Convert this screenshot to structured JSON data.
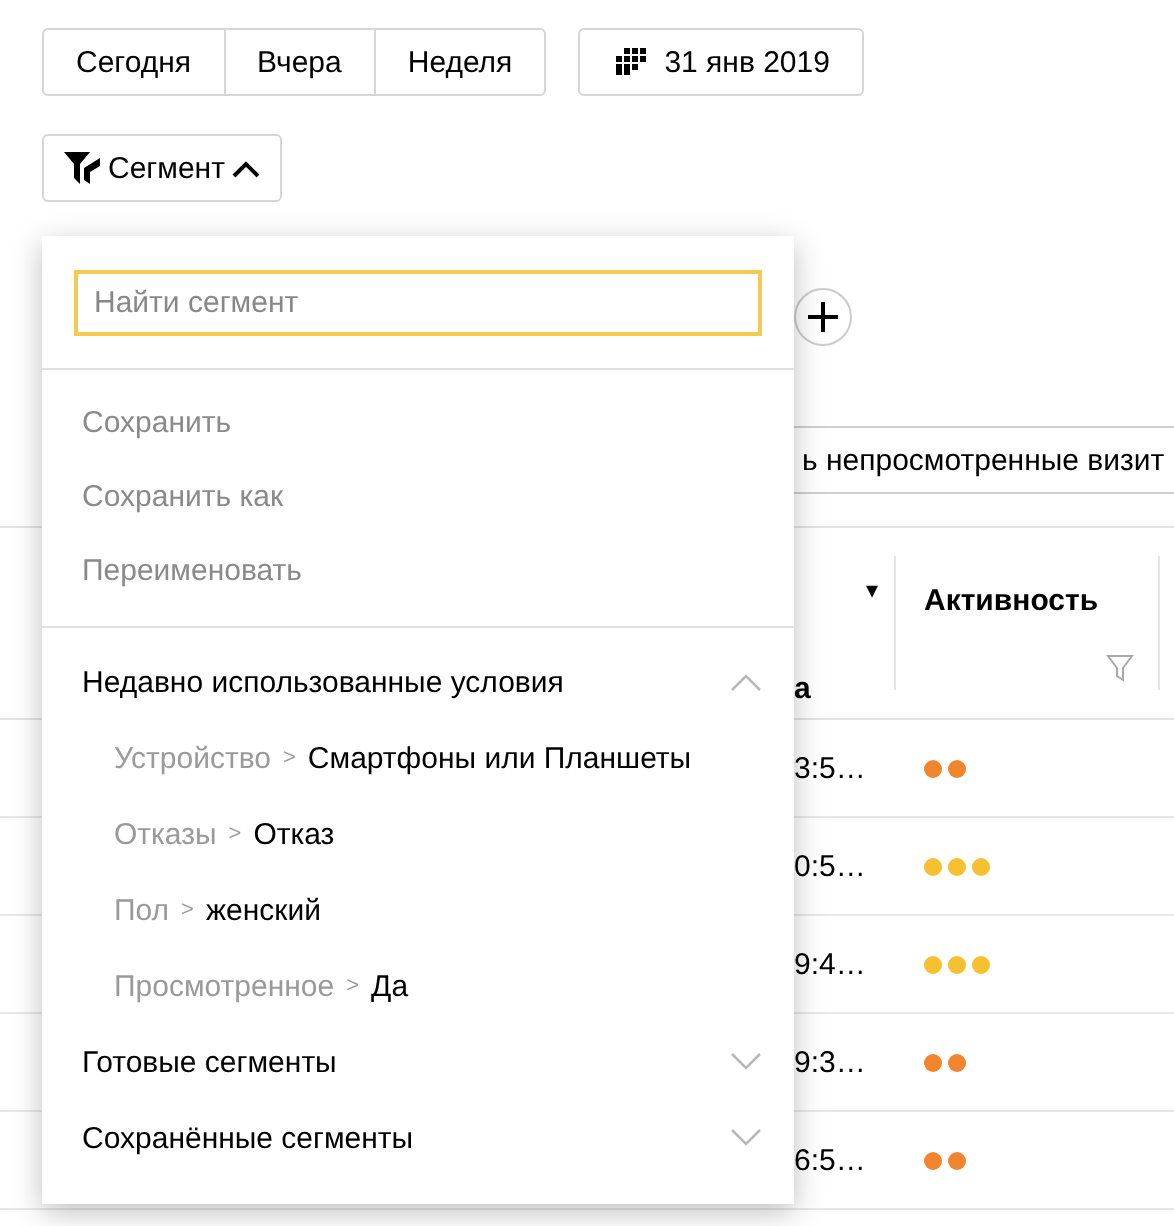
{
  "date_presets": [
    {
      "label": "Сегодня"
    },
    {
      "label": "Вчера"
    },
    {
      "label": "Неделя"
    }
  ],
  "date_picker": {
    "label": "31 янв 2019"
  },
  "segment_button": {
    "label": "Сегмент",
    "expanded": true
  },
  "segment_menu": {
    "search": {
      "placeholder": "Найти сегмент"
    },
    "actions": [
      {
        "label": "Сохранить",
        "disabled": true
      },
      {
        "label": "Сохранить как",
        "disabled": true
      },
      {
        "label": "Переименовать",
        "disabled": true
      }
    ],
    "sections": [
      {
        "title": "Недавно использованные условия",
        "expanded": true,
        "children": [
          {
            "field": "Устройство",
            "separator": ">",
            "value": "Смартфоны или Планшеты"
          },
          {
            "field": "Отказы",
            "separator": ">",
            "value": "Отказ"
          },
          {
            "field": "Пол",
            "separator": ">",
            "value": "женский"
          },
          {
            "field": "Просмотренное",
            "separator": ">",
            "value": "Да"
          }
        ]
      },
      {
        "title": "Готовые сегменты",
        "expanded": false
      },
      {
        "title": "Сохранённые сегменты",
        "expanded": false
      }
    ]
  },
  "filter_field": {
    "value": "ь непросмотренные визит"
  },
  "table": {
    "columns": [
      {
        "label": "а",
        "sort": "▾"
      },
      {
        "label": "Активность"
      }
    ],
    "rows": [
      {
        "time": "3:5…",
        "dots": [
          {
            "color": "#f0852d"
          },
          {
            "color": "#f0852d"
          }
        ]
      },
      {
        "time": "0:5…",
        "dots": [
          {
            "color": "#f6c030"
          },
          {
            "color": "#f6c030"
          },
          {
            "color": "#f6c030"
          }
        ]
      },
      {
        "time": "9:4…",
        "dots": [
          {
            "color": "#f6c030"
          },
          {
            "color": "#f6c030"
          },
          {
            "color": "#f6c030"
          }
        ]
      },
      {
        "time": "9:3…",
        "dots": [
          {
            "color": "#f0852d"
          },
          {
            "color": "#f0852d"
          }
        ]
      },
      {
        "time": "6:5…",
        "dots": [
          {
            "color": "#f0852d"
          },
          {
            "color": "#f0852d"
          }
        ]
      }
    ]
  }
}
